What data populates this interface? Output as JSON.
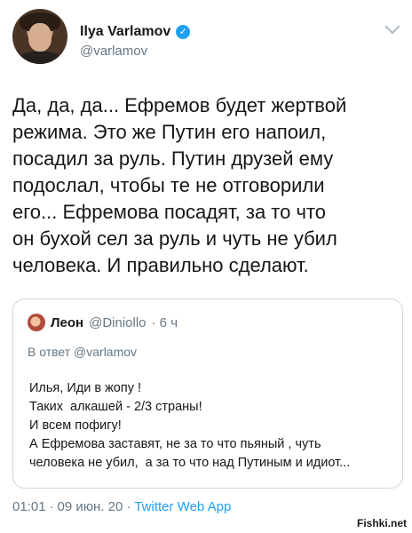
{
  "author": {
    "name": "Ilya Varlamov",
    "handle": "@varlamov",
    "verified_icon": "verified-badge-icon"
  },
  "tweet": {
    "text": "Да, да, да... Ефремов будет жертвой\nрежима. Это же Путин его напоил,\nпосадил за руль. Путин друзей ему\nподослал, чтобы те не отговорили\nего... Ефремова посадят, за то что\nон бухой сел за руль и чуть не убил\nчеловека. И правильно сделают."
  },
  "quoted": {
    "name": "Леон",
    "handle": "@Diniollo",
    "time": "· 6 ч",
    "reply_prefix": "В ответ",
    "reply_to": "@varlamov",
    "lines": [
      "Илья, Иди в жопу !",
      "Таких  алкашей - 2/3 страны!",
      "И всем пофигу!",
      "А Ефремова заставят, не за то что пьяный , чуть",
      "человека не убил,  а за то что над Путиным и идиот..."
    ]
  },
  "footer": {
    "time": "01:01",
    "sep1": "·",
    "date": "09 июн. 20",
    "sep2": "·",
    "app": "Twitter Web App"
  },
  "watermark": "Fishki.net",
  "colors": {
    "accent": "#1da1f2",
    "secondary_text": "#657786",
    "border": "#ccd6dd"
  }
}
